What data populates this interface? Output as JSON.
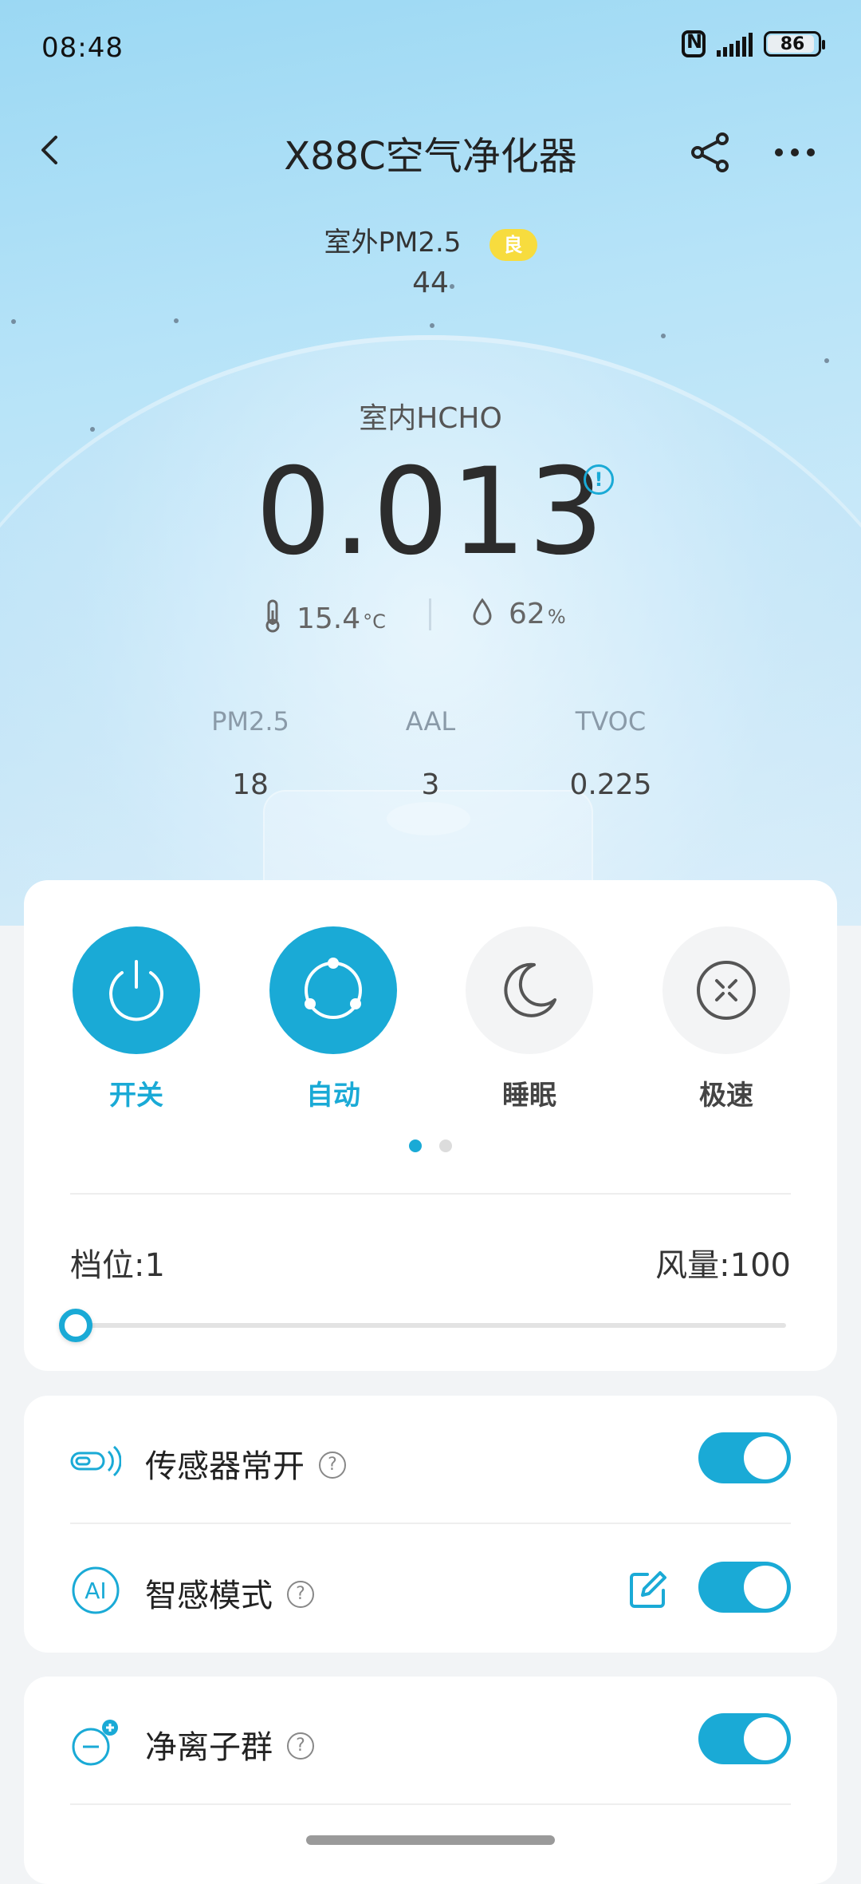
{
  "status_bar": {
    "time": "08:48",
    "battery": "86"
  },
  "header": {
    "title": "X88C空气净化器"
  },
  "outdoor": {
    "label": "室外PM2.5",
    "badge": "良",
    "value": "44"
  },
  "indoor": {
    "label": "室内HCHO",
    "value": "0.013",
    "temperature": "15.4",
    "temperature_unit": "°C",
    "humidity": "62",
    "humidity_unit": "%"
  },
  "metrics": [
    {
      "label": "PM2.5",
      "value": "18"
    },
    {
      "label": "AAL",
      "value": "3"
    },
    {
      "label": "TVOC",
      "value": "0.225"
    }
  ],
  "modes": [
    {
      "label": "开关",
      "icon": "power-icon",
      "active": true
    },
    {
      "label": "自动",
      "icon": "auto-icon",
      "active": true
    },
    {
      "label": "睡眠",
      "icon": "moon-icon",
      "active": false
    },
    {
      "label": "极速",
      "icon": "turbo-icon",
      "active": false
    }
  ],
  "pager": {
    "pages": 2,
    "current": 1
  },
  "fan": {
    "gear_label": "档位:1",
    "wind_label": "风量:100",
    "level_fraction": 0.0
  },
  "settings": [
    {
      "label": "传感器常开",
      "help": "?",
      "icon": "sensor-icon",
      "enabled": true
    },
    {
      "label": "智感模式",
      "help": "?",
      "icon": "ai-icon",
      "enabled": true,
      "editable": true
    },
    {
      "label": "净离子群",
      "help": "?",
      "icon": "ion-icon",
      "enabled": true
    }
  ],
  "colors": {
    "accent": "#1aaad6",
    "badge": "#f7dc3e"
  }
}
